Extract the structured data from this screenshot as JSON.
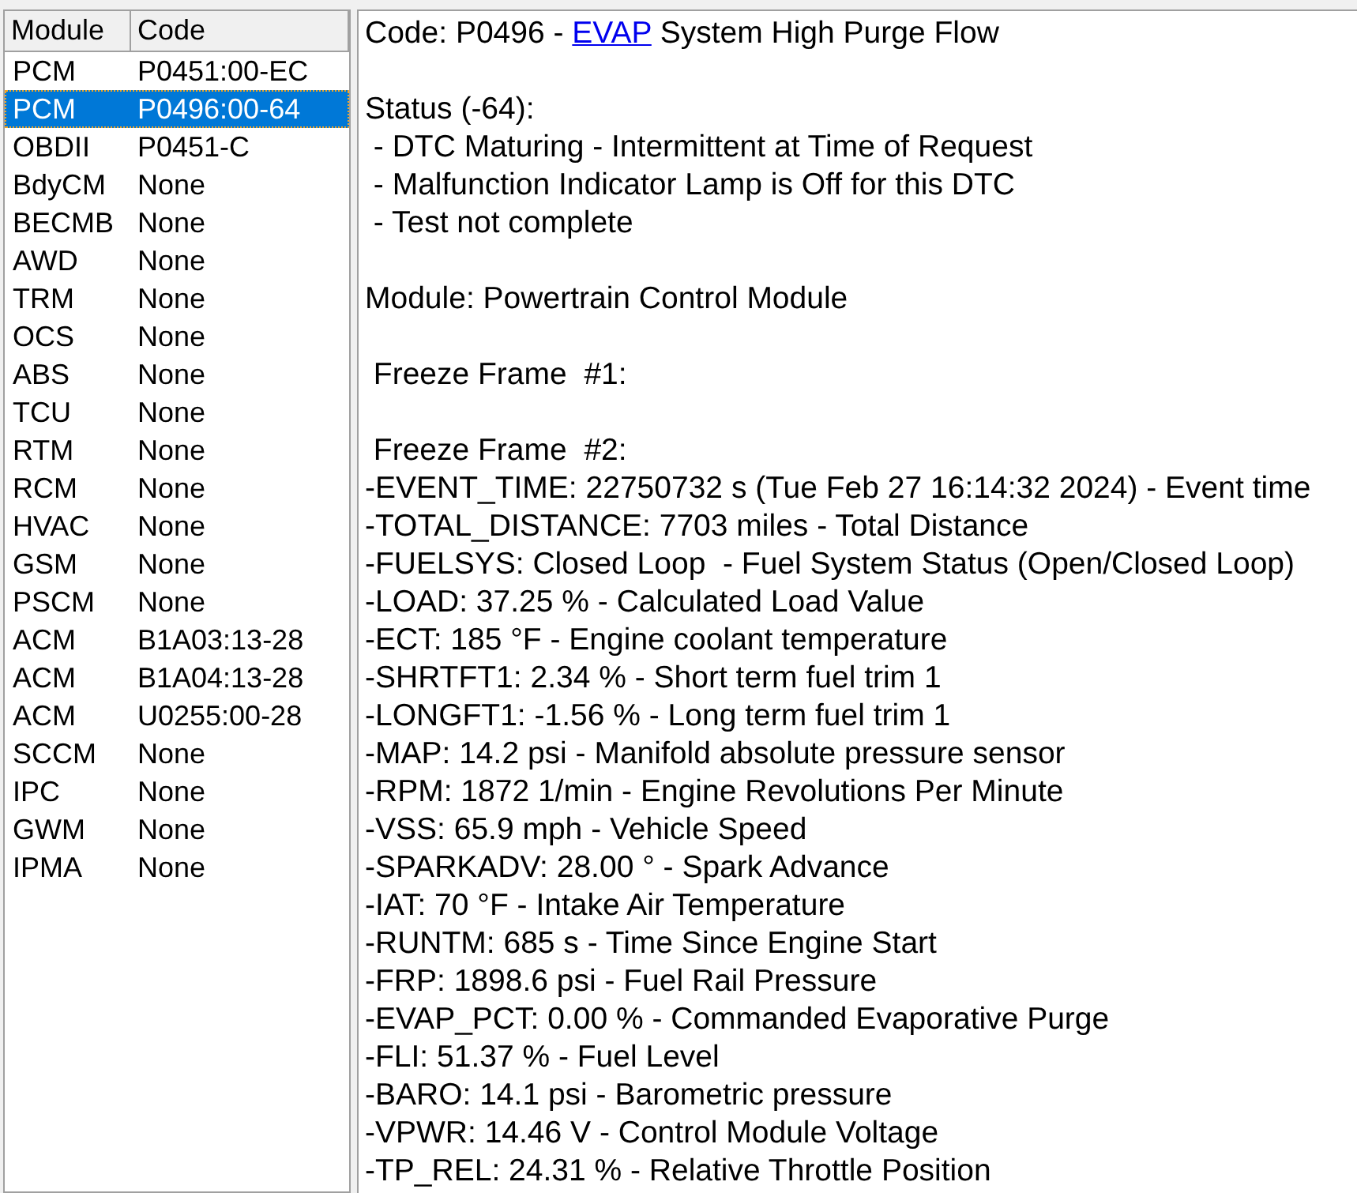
{
  "module_list": {
    "columns": [
      "Module",
      "Code"
    ],
    "rows": [
      {
        "module": "PCM",
        "code": "P0451:00-EC",
        "selected": false
      },
      {
        "module": "PCM",
        "code": "P0496:00-64",
        "selected": true
      },
      {
        "module": "OBDII",
        "code": "P0451-C",
        "selected": false
      },
      {
        "module": "BdyCM",
        "code": "None",
        "selected": false
      },
      {
        "module": "BECMB",
        "code": "None",
        "selected": false
      },
      {
        "module": "AWD",
        "code": "None",
        "selected": false
      },
      {
        "module": "TRM",
        "code": "None",
        "selected": false
      },
      {
        "module": "OCS",
        "code": "None",
        "selected": false
      },
      {
        "module": "ABS",
        "code": "None",
        "selected": false
      },
      {
        "module": "TCU",
        "code": "None",
        "selected": false
      },
      {
        "module": "RTM",
        "code": "None",
        "selected": false
      },
      {
        "module": "RCM",
        "code": "None",
        "selected": false
      },
      {
        "module": "HVAC",
        "code": "None",
        "selected": false
      },
      {
        "module": "GSM",
        "code": "None",
        "selected": false
      },
      {
        "module": "PSCM",
        "code": "None",
        "selected": false
      },
      {
        "module": "ACM",
        "code": "B1A03:13-28",
        "selected": false
      },
      {
        "module": "ACM",
        "code": "B1A04:13-28",
        "selected": false
      },
      {
        "module": "ACM",
        "code": "U0255:00-28",
        "selected": false
      },
      {
        "module": "SCCM",
        "code": "None",
        "selected": false
      },
      {
        "module": "IPC",
        "code": "None",
        "selected": false
      },
      {
        "module": "GWM",
        "code": "None",
        "selected": false
      },
      {
        "module": "IPMA",
        "code": "None",
        "selected": false
      }
    ]
  },
  "details": {
    "heading": {
      "prefix": "Code: P0496 - ",
      "link": "EVAP",
      "suffix": " System High Purge Flow"
    },
    "paragraphs": [
      {
        "lines": [
          "Status (-64):",
          " - DTC Maturing - Intermittent at Time of Request",
          " - Malfunction Indicator Lamp is Off for this DTC",
          " - Test not complete"
        ]
      },
      {
        "lines": [
          "Module: Powertrain Control Module"
        ]
      },
      {
        "lines": [
          " Freeze Frame  #1:"
        ]
      },
      {
        "lines": [
          " Freeze Frame  #2:",
          "-EVENT_TIME: 22750732 s (Tue Feb 27 16:14:32 2024) - Event time",
          "-TOTAL_DISTANCE: 7703 miles - Total Distance",
          "-FUELSYS: Closed Loop  - Fuel System Status (Open/Closed Loop)",
          "-LOAD: 37.25 % - Calculated Load Value",
          "-ECT: 185 °F - Engine coolant temperature",
          "-SHRTFT1: 2.34 % - Short term fuel trim 1",
          "-LONGFT1: -1.56 % - Long term fuel trim 1",
          "-MAP: 14.2 psi - Manifold absolute pressure sensor",
          "-RPM: 1872 1/min - Engine Revolutions Per Minute",
          "-VSS: 65.9 mph - Vehicle Speed",
          "-SPARKADV: 28.00 ° - Spark Advance",
          "-IAT: 70 °F - Intake Air Temperature",
          "-RUNTM: 685 s - Time Since Engine Start",
          "-FRP: 1898.6 psi - Fuel Rail Pressure",
          "-EVAP_PCT: 0.00 % - Commanded Evaporative Purge",
          "-FLI: 51.37 % - Fuel Level",
          "-BARO: 14.1 psi - Barometric pressure",
          "-VPWR: 14.46 V - Control Module Voltage",
          "-TP_REL: 24.31 % - Relative Throttle Position"
        ]
      }
    ]
  }
}
